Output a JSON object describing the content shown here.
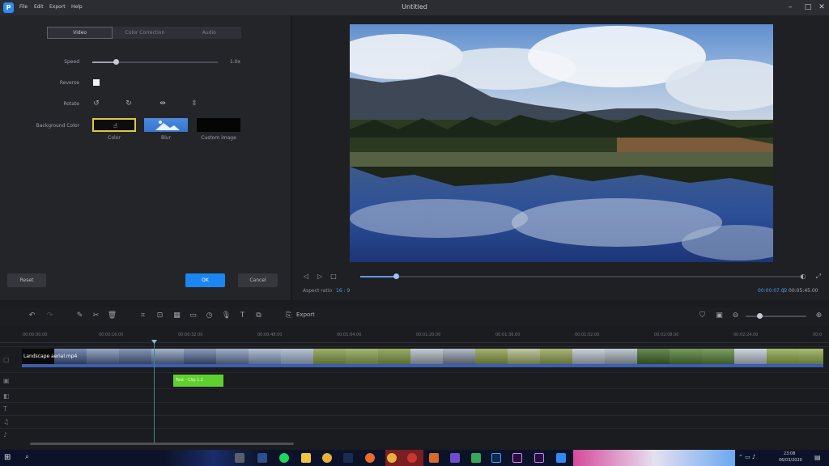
{
  "window": {
    "title": "Untitled",
    "menus": [
      "File",
      "Edit",
      "Export",
      "Help"
    ],
    "logo": "P"
  },
  "panel": {
    "tabs": [
      "Video",
      "Color Correction",
      "Audio"
    ],
    "speed_label": "Speed",
    "speed_value": "1.0x",
    "speed_fraction": 0.19,
    "reverse_label": "Reverse",
    "rotate_label": "Rotate",
    "bg_label": "Background Color",
    "bg_options": [
      "Color",
      "Blur",
      "Custom image"
    ],
    "reset": "Reset",
    "ok": "OK",
    "cancel": "Cancel"
  },
  "preview": {
    "aspect_label": "Aspect ratio",
    "aspect_value": "16 : 9",
    "time_current": "00:00:07.02",
    "time_sep": "/",
    "time_total": "00:05:45.00",
    "progress": 0.08
  },
  "toolbar": {
    "export_label": "Export",
    "zoom_fraction": 0.22
  },
  "timeline": {
    "ticks": [
      "00:00:00.00",
      "00:00:16.00",
      "00:00:32.00",
      "00:00:48.00",
      "00:01:04.00",
      "00:01:20.00",
      "00:01:36.00",
      "00:01:52.00",
      "00:02:08.00",
      "00:02:24.00",
      "00:0"
    ],
    "clip_label": "Landscape aerial.mp4",
    "text_clip": "Text - Clip 1.1"
  },
  "taskbar": {
    "time": "23:08",
    "date": "06/03/2020"
  },
  "colors": {
    "accent": "#1b86ef",
    "selected_border": "#e2c934",
    "text_clip": "#5fd12e",
    "track_underline": "#3b5fb0"
  }
}
